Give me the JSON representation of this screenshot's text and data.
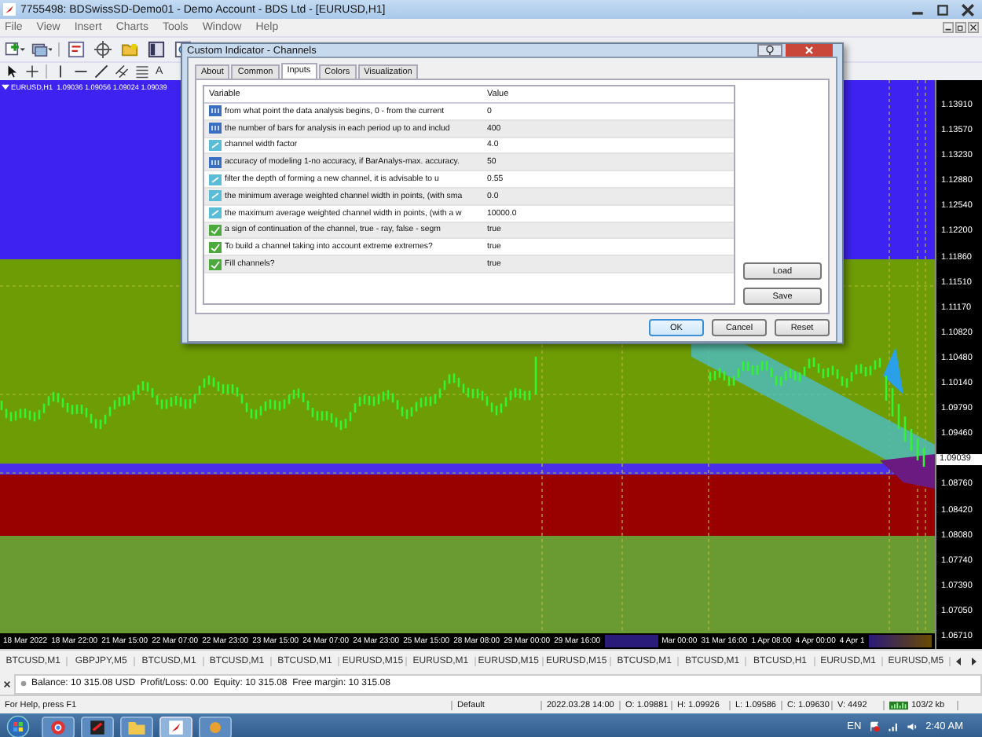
{
  "window": {
    "title": "7755498: BDSwissSD-Demo01 - Demo Account - BDS Ltd - [EURUSD,H1]"
  },
  "menu": [
    "File",
    "View",
    "Insert",
    "Charts",
    "Tools",
    "Window",
    "Help"
  ],
  "toolbar": {
    "text_tool": "A"
  },
  "chart": {
    "header": "EURUSD,H1  1.09036 1.09056 1.09024 1.09039",
    "price_labels": [
      {
        "kind": "tick",
        "text": "1.13910"
      },
      {
        "kind": "tick",
        "text": "1.13570"
      },
      {
        "kind": "tick",
        "text": "1.13230"
      },
      {
        "kind": "tick",
        "text": "1.12880"
      },
      {
        "kind": "tick",
        "text": "1.12540"
      },
      {
        "kind": "tick",
        "text": "1.12200"
      },
      {
        "kind": "tick",
        "text": "1.11860"
      },
      {
        "kind": "tick",
        "text": "1.11510"
      },
      {
        "kind": "tick",
        "text": "1.11170"
      },
      {
        "kind": "tick",
        "text": "1.10820"
      },
      {
        "kind": "tick",
        "text": "1.10480"
      },
      {
        "kind": "tick",
        "text": "1.10140"
      },
      {
        "kind": "tick",
        "text": "1.09790"
      },
      {
        "kind": "tick",
        "text": "1.09460"
      },
      {
        "kind": "current",
        "text": "1.09039"
      },
      {
        "kind": "tick",
        "text": "1.08760"
      },
      {
        "kind": "tick",
        "text": "1.08420"
      },
      {
        "kind": "tick",
        "text": "1.08080"
      },
      {
        "kind": "tick",
        "text": "1.07740"
      },
      {
        "kind": "tick",
        "text": "1.07390"
      },
      {
        "kind": "tick",
        "text": "1.07050"
      },
      {
        "kind": "tick",
        "text": "1.06710"
      }
    ],
    "time_labels": [
      "18 Mar 2022",
      "18 Mar 22:00",
      "21 Mar 15:00",
      "22 Mar 07:00",
      "22 Mar 23:00",
      "23 Mar 15:00",
      "24 Mar 07:00",
      "24 Mar 23:00",
      "25 Mar 15:00",
      "28 Mar 08:00",
      "29 Mar 00:00",
      "29 Mar 16:00",
      "Mar 00:00",
      "31 Mar 16:00",
      "1 Apr 08:00",
      "4 Apr 00:00",
      "4 Apr 1"
    ]
  },
  "dialog": {
    "title": "Custom Indicator - Channels",
    "tabs": [
      {
        "label": "About",
        "selected": false
      },
      {
        "label": "Common",
        "selected": false
      },
      {
        "label": "Inputs",
        "selected": true
      },
      {
        "label": "Colors",
        "selected": false
      },
      {
        "label": "Visualization",
        "selected": false
      }
    ],
    "columns": [
      "Variable",
      "Value"
    ],
    "rows": [
      {
        "kind": "int",
        "variable": "from what point the data analysis begins, 0 - from the current",
        "value": "0"
      },
      {
        "kind": "int",
        "variable": "the number of bars for analysis in each period up to and includ",
        "value": "400"
      },
      {
        "kind": "double",
        "variable": "channel width factor",
        "value": "4.0"
      },
      {
        "kind": "int",
        "variable": "accuracy of modeling 1-no accuracy, if BarAnalys-max. accuracy.",
        "value": "50"
      },
      {
        "kind": "double",
        "variable": "filter the depth of forming a new channel, it is advisable to u",
        "value": "0.55"
      },
      {
        "kind": "double",
        "variable": "the minimum average weighted channel width in points, (with sma",
        "value": "0.0"
      },
      {
        "kind": "double",
        "variable": "the maximum average weighted channel width in points, (with a w",
        "value": "10000.0"
      },
      {
        "kind": "bool",
        "variable": "a sign of continuation of the channel, true - ray, false - segm",
        "value": "true"
      },
      {
        "kind": "bool",
        "variable": "To build a channel taking into account extreme extremes?",
        "value": "true"
      },
      {
        "kind": "bool",
        "variable": "Fill channels?",
        "value": "true"
      }
    ],
    "side_buttons": [
      "Load",
      "Save"
    ],
    "buttons": [
      {
        "label": "OK",
        "default": true
      },
      {
        "label": "Cancel",
        "default": false
      },
      {
        "label": "Reset",
        "default": false
      }
    ]
  },
  "chart_tabs": [
    "BTCUSD,M1",
    "GBPJPY,M5",
    "BTCUSD,M1",
    "BTCUSD,M1",
    "BTCUSD,M1",
    "EURUSD,M15",
    "EURUSD,M1",
    "EURUSD,M15",
    "EURUSD,M15",
    "BTCUSD,M1",
    "BTCUSD,M1",
    "BTCUSD,H1",
    "EURUSD,M1",
    "EURUSD,M5"
  ],
  "terminal": {
    "account": "Balance: 10 315.08 USD  Profit/Loss: 0.00  Equity: 10 315.08  Free margin: 10 315.08"
  },
  "status_bar": [
    "For Help, press F1",
    "Default",
    "2022.03.28 14:00",
    "O: 1.09881",
    "H: 1.09926",
    "L: 1.09586",
    "C: 1.09630",
    "V: 4492",
    "103/2 kb"
  ],
  "taskbar": {
    "language": "EN",
    "time": "2:40 AM"
  }
}
